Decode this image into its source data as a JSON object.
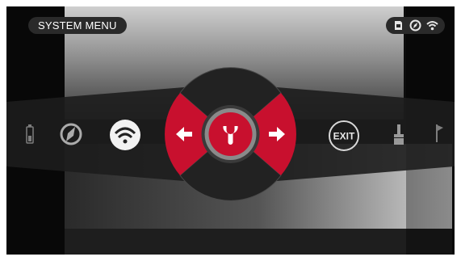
{
  "header": {
    "title": "SYSTEM MENU"
  },
  "status_bar": {
    "icons": [
      "sd-card-icon",
      "compass-icon",
      "wifi-icon"
    ]
  },
  "carousel": {
    "items": [
      {
        "name": "battery-icon"
      },
      {
        "name": "compass-icon"
      },
      {
        "name": "wifi-icon"
      },
      {
        "name": "wrench-icon",
        "selected": true
      },
      {
        "name": "exit-icon",
        "label": "EXIT"
      },
      {
        "name": "brush-icon"
      },
      {
        "name": "flag-icon"
      }
    ]
  },
  "dial": {
    "left_arrow": "arrow-left-icon",
    "right_arrow": "arrow-right-icon",
    "center": "wrench-icon"
  },
  "colors": {
    "accent": "#c8102e",
    "panel": "#2a2a2a",
    "icon": "#e0e0e0"
  }
}
